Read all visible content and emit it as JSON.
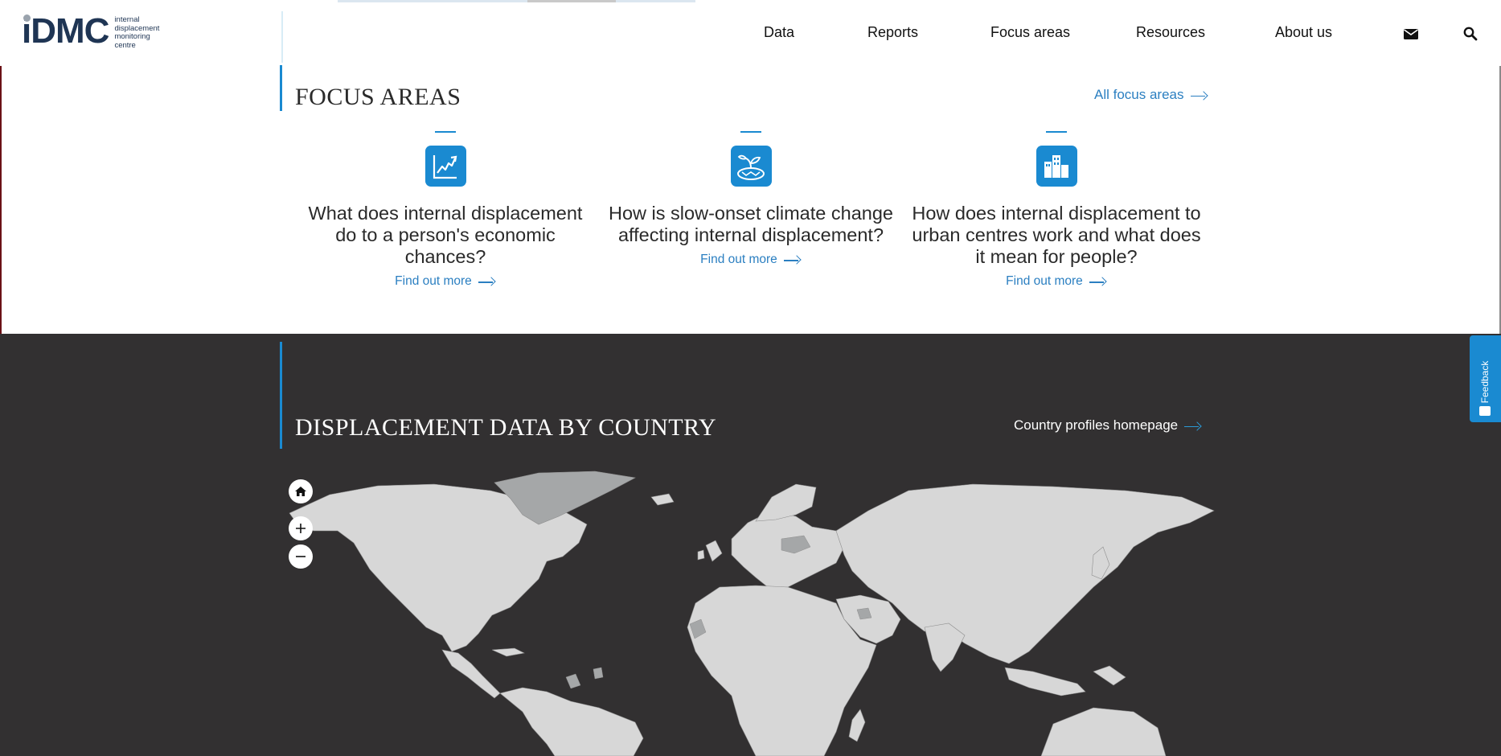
{
  "logo": {
    "mark": "iDMC",
    "tagline": [
      "internal",
      "displacement",
      "monitoring",
      "centre"
    ]
  },
  "nav": {
    "items": [
      "Data",
      "Reports",
      "Focus areas",
      "Resources",
      "About us"
    ],
    "icons": [
      "envelope-icon",
      "search-icon"
    ]
  },
  "focus": {
    "title": "FOCUS AREAS",
    "all_link": "All focus areas",
    "cards": [
      {
        "icon": "economic-chart-icon",
        "title": "What does internal displacement do to a person's economic chances?",
        "link": "Find out more"
      },
      {
        "icon": "climate-plant-icon",
        "title": "How is slow-onset climate change affecting internal displacement?",
        "link": "Find out more"
      },
      {
        "icon": "urban-buildings-icon",
        "title": "How does internal displacement to urban centres work and what does it mean for people?",
        "link": "Find out more"
      }
    ]
  },
  "country": {
    "title": "DISPLACEMENT DATA BY COUNTRY",
    "link": "Country profiles homepage",
    "map_controls": [
      "home-icon",
      "zoom-in-icon",
      "zoom-out-icon"
    ]
  },
  "feedback": {
    "label": "Feedback"
  },
  "colors": {
    "accent": "#1a8ad1",
    "link": "#2b7fc1",
    "dark_bg": "#323031",
    "land": "#d7d7d7",
    "highlight_land": "#a5a7a8"
  }
}
